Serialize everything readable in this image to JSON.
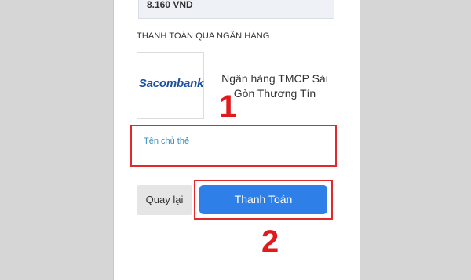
{
  "payment": {
    "amount": "8.160 VND",
    "section_label": "THANH TOÁN QUA NGÂN HÀNG",
    "bank": {
      "logo_text": "Sacombank",
      "name": "Ngân hàng TMCP Sài Gòn Thương Tín"
    },
    "card_holder": {
      "label": "Tên chủ thẻ",
      "value": ""
    },
    "back_label": "Quay lại",
    "pay_label": "Thanh Toán"
  },
  "annotations": {
    "step1": "1",
    "step2": "2"
  },
  "colors": {
    "accent": "#2f7fe9",
    "highlight": "#e0282d",
    "label": "#3a8fc2",
    "bank_brand": "#1b4fa0"
  }
}
